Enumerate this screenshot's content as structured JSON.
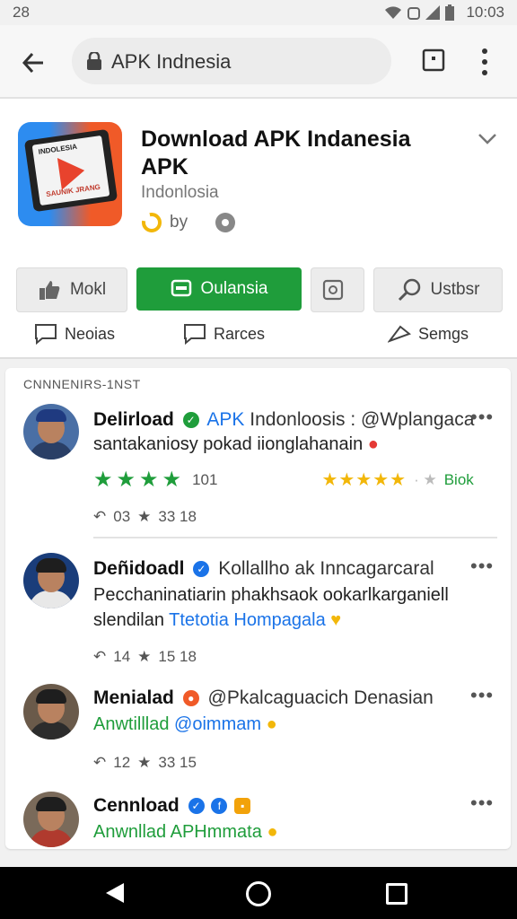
{
  "status_bar": {
    "left_text": "28",
    "time": "10:03"
  },
  "browser": {
    "url_text": "APK Indnesia"
  },
  "app": {
    "icon_label_top": "INDOLESIA",
    "icon_label_bottom": "SAUNIK JRANG",
    "title": "Download APK Indanesia APK",
    "subtitle": "Indonlosia",
    "by": "by",
    "buttons": [
      "Mokl",
      "Oulansia",
      "",
      "Ustbsr"
    ],
    "actions": [
      "Neoias",
      "Rarces",
      "Semgs"
    ]
  },
  "feed": {
    "section_label": "CNNNENIRS-1NST",
    "posts": [
      {
        "name": "Delirload",
        "handle_blue": "APK",
        "handle_rest": "Indonloosis : @Wplangaca",
        "line1": "santakaniosy pokad iionglahanain",
        "rating_left": "101",
        "rating_right": "Biok",
        "reply_count": "03",
        "star_count": "33 18"
      },
      {
        "name": "Deñidoadl",
        "handle_rest": "Kollallho ak Inncagarcaral",
        "line1": "Pecchaninatiarin phakhsaok ookarlkarganiell",
        "line2_plain": "slendilan",
        "line2_blue": "Ttetotia Hompagala",
        "reply_count": "14",
        "star_count": "15 18"
      },
      {
        "name": "Menialad",
        "handle_rest": "@Pkalcaguacich Denasian",
        "line1_green": "Anwtilllad",
        "line1_blue": "@oimmam",
        "reply_count": "12",
        "star_count": "33 15"
      },
      {
        "name": "Cennload",
        "line1": "Anwnllad APHmmata"
      }
    ]
  },
  "colors": {
    "accent_green": "#1f9d3b",
    "link_blue": "#1a73e8",
    "star_yellow": "#f2b70a"
  }
}
